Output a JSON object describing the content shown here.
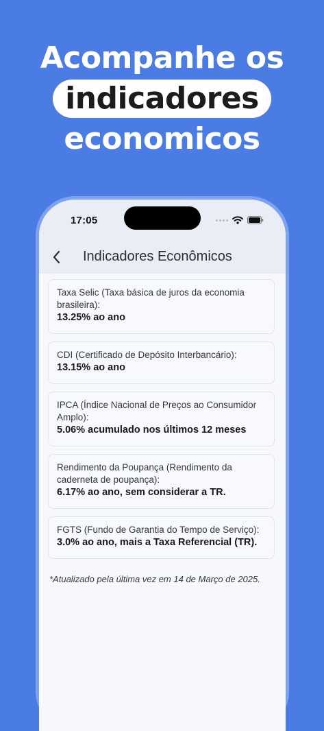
{
  "headline": {
    "line1": "Acompanhe os",
    "highlight": "indicadores",
    "line3": "economicos"
  },
  "status_bar": {
    "time": "17:05",
    "icons": [
      "signal-dots-icon",
      "wifi-icon",
      "battery-icon"
    ]
  },
  "nav": {
    "back_icon": "chevron-left-icon",
    "title": "Indicadores Econômicos"
  },
  "indicators": [
    {
      "label": "Taxa Selic (Taxa básica de juros da economia brasileira):",
      "value": "13.25% ao ano"
    },
    {
      "label": "CDI (Certificado de Depósito Interbancário):",
      "value": "13.15% ao ano"
    },
    {
      "label": "IPCA (Índice Nacional de Preços ao Consumidor Amplo):",
      "value": "5.06% acumulado nos últimos 12 meses"
    },
    {
      "label": "Rendimento da Poupança (Rendimento da caderneta de poupança):",
      "value": "6.17% ao ano, sem considerar a TR."
    },
    {
      "label": "FGTS (Fundo de Garantia do Tempo de Serviço):",
      "value": "3.0% ao ano, mais a Taxa Referencial (TR)."
    }
  ],
  "footnote": "*Atualizado pela última vez em 14 de Março de 2025.",
  "colors": {
    "background": "#4a7ce3",
    "phone_frame": "#7ea3ee",
    "header_bar": "#e9edf6",
    "card_border": "#e2e5ec"
  }
}
